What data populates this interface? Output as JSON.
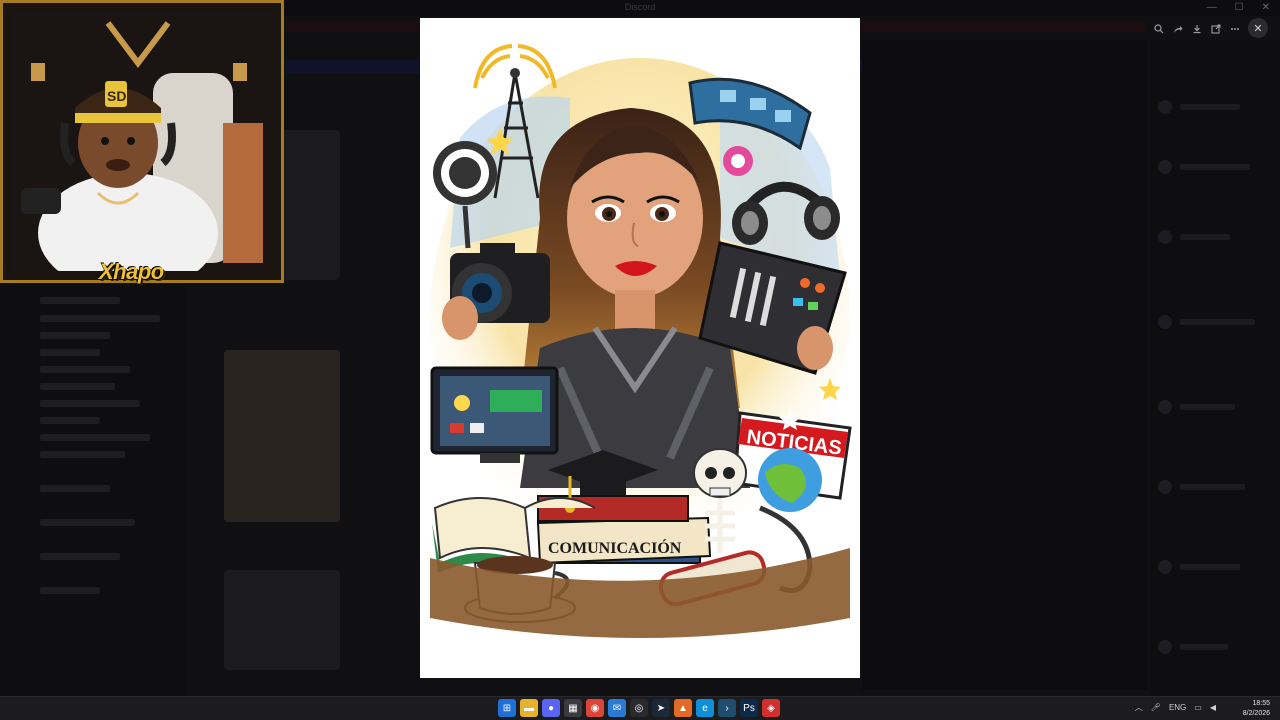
{
  "window": {
    "title": "Discord"
  },
  "viewer": {
    "tools": [
      "zoom-icon",
      "share-icon",
      "download-icon",
      "open-external-icon",
      "more-icon"
    ],
    "close_glyph": "✕",
    "image_text": {
      "banner": "NOTICIAS",
      "scroll": "COMUNICACIÓN"
    }
  },
  "webcam": {
    "logo": "Xhapo",
    "cap_logo": "SD"
  },
  "taskbar": {
    "tray_lang": "ENG",
    "clock_time": "18:55",
    "clock_date": "8/2/2026"
  },
  "colors": {
    "accent": "#a57c1e",
    "logo": "#f1c135",
    "lips": "#d2141c",
    "banner": "#d4191f"
  }
}
